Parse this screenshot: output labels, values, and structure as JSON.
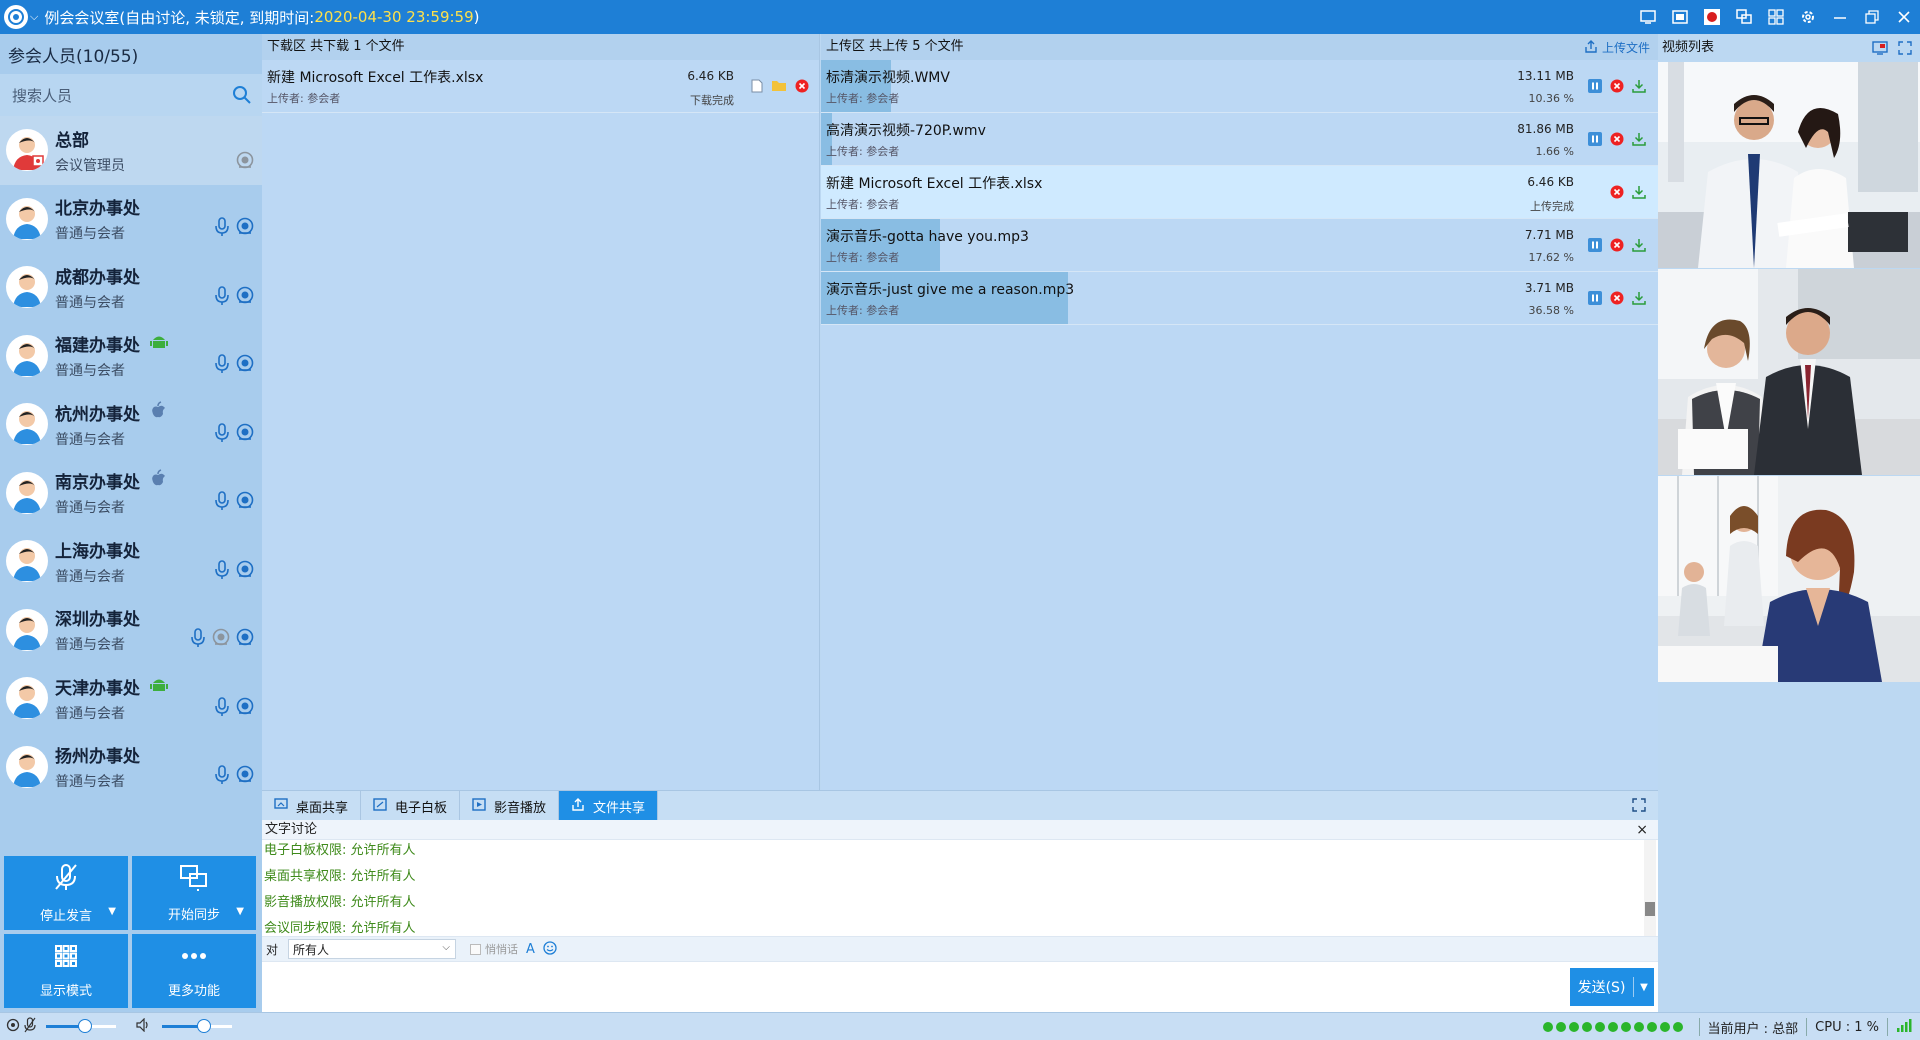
{
  "titlebar": {
    "title": "例会会议室(自由讨论, 未锁定, 到期时间: ",
    "expire_time": "2020-04-30 23:59:59",
    "title_end": ")"
  },
  "members": {
    "header": "参会人员(10/55)",
    "search_placeholder": "搜索人员",
    "items": [
      {
        "name": "总部",
        "role": "会议管理员",
        "admin": true
      },
      {
        "name": "北京办事处",
        "role": "普通与会者"
      },
      {
        "name": "成都办事处",
        "role": "普通与会者"
      },
      {
        "name": "福建办事处",
        "role": "普通与会者",
        "platform": "android"
      },
      {
        "name": "杭州办事处",
        "role": "普通与会者",
        "platform": "apple"
      },
      {
        "name": "南京办事处",
        "role": "普通与会者",
        "platform": "apple"
      },
      {
        "name": "上海办事处",
        "role": "普通与会者"
      },
      {
        "name": "深圳办事处",
        "role": "普通与会者"
      },
      {
        "name": "天津办事处",
        "role": "普通与会者",
        "platform": "android"
      },
      {
        "name": "扬州办事处",
        "role": "普通与会者"
      }
    ]
  },
  "buttons": {
    "stop_speaking": "停止发言",
    "start_sync": "开始同步",
    "display_mode": "显示模式",
    "more_functions": "更多功能"
  },
  "download": {
    "header": "下载区 共下载 1 个文件",
    "files": [
      {
        "name": "新建 Microsoft Excel 工作表.xlsx",
        "uploader": "上传者: 参会者",
        "size": "6.46 KB",
        "status": "下载完成"
      }
    ]
  },
  "upload": {
    "header": "上传区 共上传 5 个文件",
    "upload_button": "上传文件",
    "files": [
      {
        "name": "标清演示视频.WMV",
        "uploader": "上传者: 参会者",
        "size": "13.11 MB",
        "status": "10.36 %",
        "progress": 0.1036
      },
      {
        "name": "高清演示视频-720P.wmv",
        "uploader": "上传者: 参会者",
        "size": "81.86 MB",
        "status": "1.66 %",
        "progress": 0.0166
      },
      {
        "name": "新建 Microsoft Excel 工作表.xlsx",
        "uploader": "上传者: 参会者",
        "size": "6.46 KB",
        "status": "上传完成",
        "progress": 1
      },
      {
        "name": "演示音乐-gotta have you.mp3",
        "uploader": "上传者: 参会者",
        "size": "7.71 MB",
        "status": "17.62 %",
        "progress": 0.1762
      },
      {
        "name": "演示音乐-just give me a reason.mp3",
        "uploader": "上传者: 参会者",
        "size": "3.71 MB",
        "status": "36.58 %",
        "progress": 0.3658
      }
    ]
  },
  "video": {
    "header": "视频列表"
  },
  "tabs": [
    {
      "label": "桌面共享"
    },
    {
      "label": "电子白板"
    },
    {
      "label": "影音播放"
    },
    {
      "label": "文件共享",
      "active": true
    }
  ],
  "chat": {
    "header": "文字讨论",
    "messages": [
      "电子白板权限: 允许所有人",
      "桌面共享权限: 允许所有人",
      "影音播放权限: 允许所有人",
      "会议同步权限: 允许所有人"
    ],
    "to_label": "对",
    "recipient": "所有人",
    "whisper_label": "悄悄话",
    "send_label": "发送(S)"
  },
  "status": {
    "current_user": "当前用户 : 总部",
    "cpu": "CPU : 1 %",
    "mic_level": 0.55,
    "speaker_level": 0.6
  },
  "colors": {
    "accent": "#1f8fe5",
    "titlebar": "#1e7fd6",
    "expire_time": "#ffe14a",
    "chat_text": "#3e8a1a"
  }
}
